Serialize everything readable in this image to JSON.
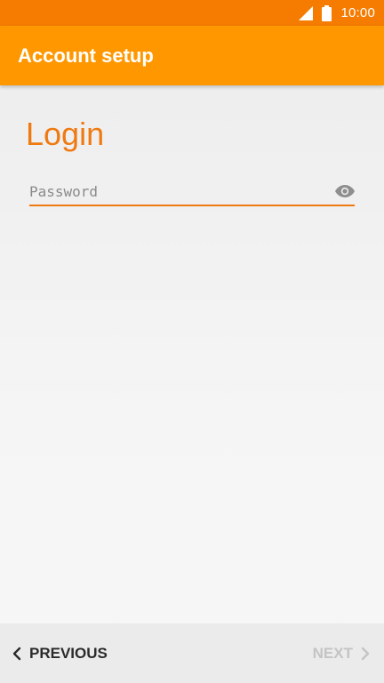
{
  "status_bar": {
    "time": "10:00",
    "icons": [
      "signal-icon",
      "battery-icon"
    ]
  },
  "app_bar": {
    "title": "Account setup"
  },
  "main": {
    "heading": "Login",
    "password_field": {
      "placeholder": "Password",
      "value": "",
      "toggle_icon": "eye-icon"
    }
  },
  "bottom_bar": {
    "previous_label": "PREVIOUS",
    "next_label": "NEXT",
    "previous_icon": "chevron-left-icon",
    "next_icon": "chevron-right-icon"
  },
  "colors": {
    "status_bar": "#f57c00",
    "app_bar": "#ff9800",
    "accent": "#ef7a12",
    "next_disabled": "#c4c4c4"
  }
}
